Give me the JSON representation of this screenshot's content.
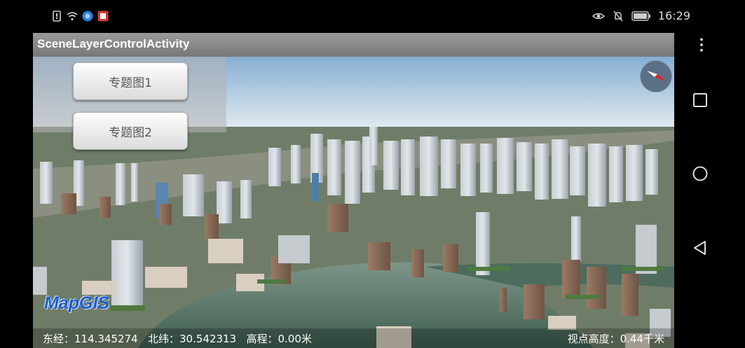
{
  "status_bar": {
    "left_icons": [
      "sim-icon",
      "wifi-icon",
      "browser-icon",
      "notification-app-icon"
    ],
    "right_icons": [
      "eye-icon",
      "mute-icon",
      "battery-icon"
    ],
    "time": "16:29"
  },
  "app": {
    "title": "SceneLayerControlActivity",
    "buttons": {
      "thematic1": "专题图1",
      "thematic2": "专题图2"
    },
    "logo": "MapGIS",
    "info": {
      "lon_label": "东经：",
      "lon_value": "114.345274",
      "lat_label": "北纬：",
      "lat_value": "30.542313",
      "elev_label": "高程：",
      "elev_value": "0.00米",
      "view_label": "视点高度：",
      "view_value": "0.44千米"
    }
  },
  "nav_bar": {
    "icons": [
      "more-icon",
      "recents-icon",
      "home-icon",
      "back-icon"
    ]
  },
  "colors": {
    "title_bar": "#8a8a8a",
    "sky_top": "#86aed2",
    "water": "#4f6e60",
    "logo": "#1e5cc8"
  }
}
